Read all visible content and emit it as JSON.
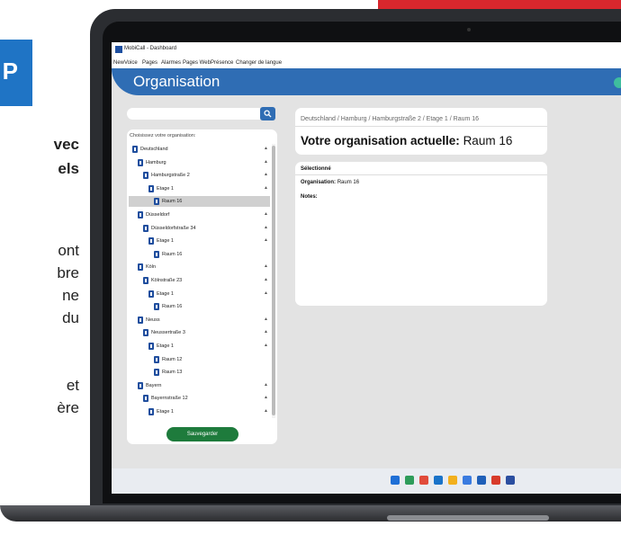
{
  "background": {
    "badge_letter": "P",
    "text_lines": [
      "vec",
      "els",
      "ont",
      "bre",
      "ne",
      "du",
      "et",
      "ère"
    ]
  },
  "window": {
    "title": "MobiCall - Dashboard",
    "menu": [
      "NewVoice",
      "Pages",
      "Alarmes",
      "Pages Web",
      "Présence",
      "Changer de langue"
    ]
  },
  "header": {
    "title": "Organisation",
    "accent_color": "#2f6db4"
  },
  "search": {
    "placeholder": "",
    "button_icon": "search-icon"
  },
  "tree": {
    "hint": "Choisissez votre organisation:",
    "items": [
      {
        "label": "Deutschland",
        "level": 0,
        "chevron": "▲"
      },
      {
        "label": "Hamburg",
        "level": 1,
        "chevron": "▲"
      },
      {
        "label": "Hamburgstraße 2",
        "level": 2,
        "chevron": "▲"
      },
      {
        "label": "Etage 1",
        "level": 3,
        "chevron": "▲"
      },
      {
        "label": "Raum 16",
        "level": 4,
        "chevron": "",
        "selected": true
      },
      {
        "label": "Düsseldorf",
        "level": 1,
        "chevron": "▲"
      },
      {
        "label": "Düsseldorfstraße 34",
        "level": 2,
        "chevron": "▲"
      },
      {
        "label": "Etage 1",
        "level": 3,
        "chevron": "▲"
      },
      {
        "label": "Raum 16",
        "level": 4,
        "chevron": ""
      },
      {
        "label": "Köln",
        "level": 1,
        "chevron": "▲"
      },
      {
        "label": "Kölnstraße 23",
        "level": 2,
        "chevron": "▲"
      },
      {
        "label": "Etage 1",
        "level": 3,
        "chevron": "▲"
      },
      {
        "label": "Raum 16",
        "level": 4,
        "chevron": ""
      },
      {
        "label": "Neuss",
        "level": 1,
        "chevron": "▲"
      },
      {
        "label": "Neussertraße 3",
        "level": 2,
        "chevron": "▲"
      },
      {
        "label": "Etage 1",
        "level": 3,
        "chevron": "▲"
      },
      {
        "label": "Raum 12",
        "level": 4,
        "chevron": ""
      },
      {
        "label": "Raum 13",
        "level": 4,
        "chevron": ""
      },
      {
        "label": "Bayern",
        "level": 1,
        "chevron": "▲"
      },
      {
        "label": "Bayernstraße 12",
        "level": 2,
        "chevron": "▲"
      },
      {
        "label": "Etage 1",
        "level": 3,
        "chevron": "▲"
      }
    ],
    "save_label": "Sauvegarder",
    "save_color": "#1e7b3c"
  },
  "current": {
    "breadcrumb": "Deutschland / Hamburg / Hamburgstraße 2 / Etage 1 / Raum 16",
    "label": "Votre organisation actuelle:",
    "value": "Raum 16"
  },
  "details": {
    "selected_title": "Sélectionné",
    "org_label": "Organisation:",
    "org_value": "Raum 16",
    "notes_label": "Notes:"
  },
  "taskbar": {
    "icons": [
      {
        "name": "windows-start-icon",
        "color": "#1f6fd6"
      },
      {
        "name": "chrome-icon",
        "color": "#2e9c5a"
      },
      {
        "name": "browser-icon",
        "color": "#e14b3b"
      },
      {
        "name": "edge-icon",
        "color": "#1a73c9"
      },
      {
        "name": "file-explorer-icon",
        "color": "#f2b01e"
      },
      {
        "name": "app-icon",
        "color": "#3a7be0"
      },
      {
        "name": "store-icon",
        "color": "#1f5fb8"
      },
      {
        "name": "office-icon",
        "color": "#d83b2b"
      },
      {
        "name": "mobicall-icon",
        "color": "#2b4ea0"
      }
    ]
  }
}
